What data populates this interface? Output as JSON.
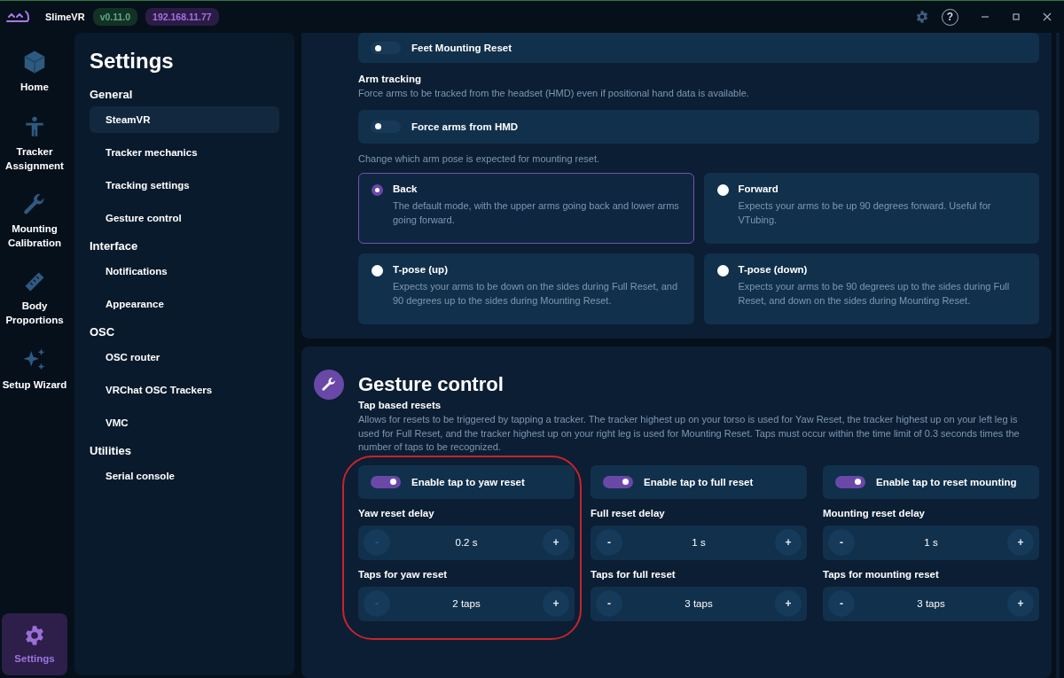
{
  "titlebar": {
    "app_name": "SlimeVR",
    "version": "v0.11.0",
    "address": "192.168.11.77",
    "help": "?"
  },
  "nav": [
    {
      "label": "Home",
      "kind": "cube",
      "selected": false
    },
    {
      "label": "Tracker Assignment",
      "kind": "person",
      "selected": false
    },
    {
      "label": "Mounting Calibration",
      "kind": "wrench",
      "selected": false
    },
    {
      "label": "Body Proportions",
      "kind": "ruler",
      "selected": false
    },
    {
      "label": "Setup Wizard",
      "kind": "sparkles",
      "selected": false
    }
  ],
  "nav_bottom": {
    "label": "Settings",
    "kind": "gear",
    "selected": true
  },
  "settings_menu": {
    "title": "Settings",
    "groups": [
      {
        "title": "General",
        "items": [
          {
            "label": "SteamVR",
            "selected": true
          },
          {
            "label": "Tracker mechanics",
            "selected": false
          },
          {
            "label": "Tracking settings",
            "selected": false
          },
          {
            "label": "Gesture control",
            "selected": false
          }
        ]
      },
      {
        "title": "Interface",
        "items": [
          {
            "label": "Notifications",
            "selected": false
          },
          {
            "label": "Appearance",
            "selected": false
          }
        ]
      },
      {
        "title": "OSC",
        "items": [
          {
            "label": "OSC router",
            "selected": false
          },
          {
            "label": "VRChat OSC Trackers",
            "selected": false
          },
          {
            "label": "VMC",
            "selected": false
          }
        ]
      },
      {
        "title": "Utilities",
        "items": [
          {
            "label": "Serial console",
            "selected": false
          }
        ]
      }
    ]
  },
  "steamvr_section": {
    "toggle": {
      "label": "Feet Mounting Reset",
      "on": false
    },
    "arm_tracking": {
      "title": "Arm tracking",
      "description": "Force arms to be tracked from the headset (HMD) even if positional hand data is available.",
      "toggle": {
        "label": "Force arms from HMD",
        "on": false
      },
      "pose_prompt": "Change which arm pose is expected for mounting reset.",
      "poses": [
        {
          "title": "Back",
          "description": "The default mode, with the upper arms going back and lower arms going forward.",
          "selected": true
        },
        {
          "title": "Forward",
          "description": "Expects your arms to be up 90 degrees forward. Useful for VTubing.",
          "selected": false
        },
        {
          "title": "T-pose (up)",
          "description": "Expects your arms to be down on the sides during Full Reset, and 90 degrees up to the sides during Mounting Reset.",
          "selected": false
        },
        {
          "title": "T-pose (down)",
          "description": "Expects your arms to be 90 degrees up to the sides during Full Reset, and down on the sides during Mounting Reset.",
          "selected": false
        }
      ]
    }
  },
  "gesture_section": {
    "title": "Gesture control",
    "subtitle": "Tap based resets",
    "description": "Allows for resets to be triggered by tapping a tracker. The tracker highest up on your torso is used for Yaw Reset, the tracker highest up on your left leg is used for Full Reset, and the tracker highest up on your right leg is used for Mounting Reset. Taps must occur within the time limit of 0.3 seconds times the number of taps to be recognized.",
    "columns": [
      {
        "highlighted": true,
        "toggle": {
          "label": "Enable tap to yaw reset",
          "on": true
        },
        "steppers": [
          {
            "label": "Yaw reset delay",
            "value": "0.2 s",
            "minus": "-",
            "plus": "+",
            "minus_disabled": true
          },
          {
            "label": "Taps for yaw reset",
            "value": "2 taps",
            "minus": "-",
            "plus": "+",
            "minus_disabled": true
          }
        ]
      },
      {
        "highlighted": false,
        "toggle": {
          "label": "Enable tap to full reset",
          "on": true
        },
        "steppers": [
          {
            "label": "Full reset delay",
            "value": "1 s",
            "minus": "-",
            "plus": "+",
            "minus_disabled": false
          },
          {
            "label": "Taps for full reset",
            "value": "3 taps",
            "minus": "-",
            "plus": "+",
            "minus_disabled": false
          }
        ]
      },
      {
        "highlighted": false,
        "toggle": {
          "label": "Enable tap to reset mounting",
          "on": true
        },
        "steppers": [
          {
            "label": "Mounting reset delay",
            "value": "1 s",
            "minus": "-",
            "plus": "+",
            "minus_disabled": false
          },
          {
            "label": "Taps for mounting reset",
            "value": "3 taps",
            "minus": "-",
            "plus": "+",
            "minus_disabled": false
          }
        ]
      }
    ]
  }
}
